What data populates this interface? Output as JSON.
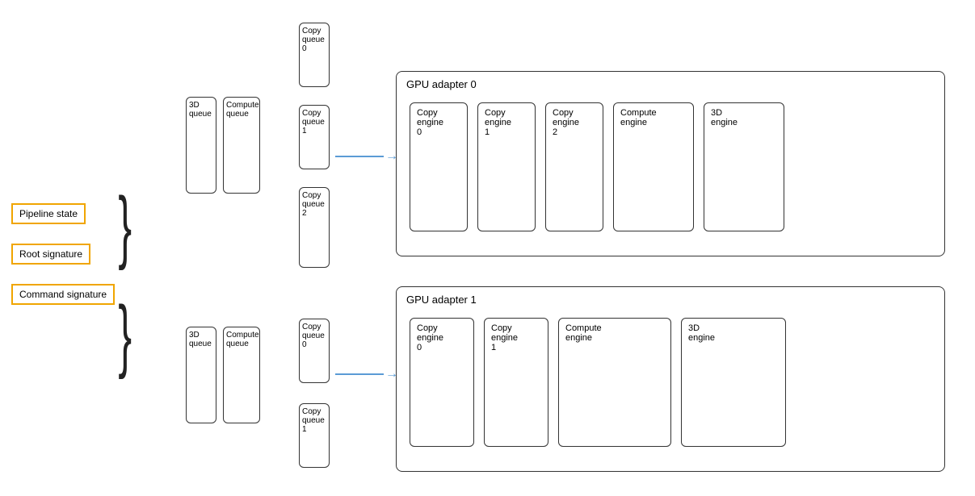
{
  "labels": {
    "pipeline_state": "Pipeline state",
    "root_signature": "Root signature",
    "command_signature": "Command signature",
    "gpu_adapter_0": "GPU adapter 0",
    "gpu_adapter_1": "GPU adapter 1"
  },
  "adapter0": {
    "queues_group1": {
      "q3d": "3D\nqueue",
      "qcompute": "Compute\nqueue"
    },
    "copy_queues": [
      "Copy\nqueue\n0",
      "Copy\nqueue\n1",
      "Copy\nqueue\n2"
    ],
    "engines": [
      "Copy\nengine\n0",
      "Copy\nengine\n1",
      "Copy\nengine\n2",
      "Compute\nengine",
      "3D\nengine"
    ]
  },
  "adapter1": {
    "queues_group1": {
      "q3d": "3D\nqueue",
      "qcompute": "Compute\nqueue"
    },
    "copy_queues": [
      "Copy\nqueue\n0",
      "Copy\nqueue\n1"
    ],
    "engines": [
      "Copy\nengine\n0",
      "Copy\nengine\n1",
      "Compute\nengine",
      "3D\nengine"
    ]
  }
}
